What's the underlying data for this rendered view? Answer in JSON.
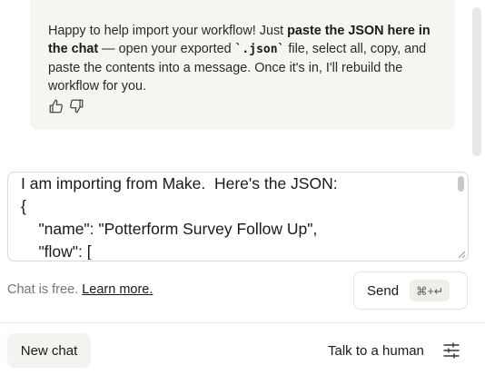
{
  "message": {
    "p1": "Happy to help import your workflow! Just ",
    "b1": "paste the JSON here in the chat",
    "p2": " — open your exported ",
    "code": "`.json`",
    "p3": " file, select all, copy, and paste the contents into a message. Once it's in, I'll rebuild the workflow for you.",
    "reactions": [
      "thumbs-up-icon",
      "thumbs-down-icon"
    ]
  },
  "composer": {
    "value": "I am importing from Make.  Here's the JSON:\n{\n    \"name\": \"Potterform Survey Follow Up\",\n    \"flow\": ["
  },
  "footer": {
    "free_text": "Chat is free.",
    "learn_more": "Learn more.",
    "send_label": "Send",
    "shortcut": "⌘+↵"
  },
  "bottom": {
    "new_chat": "New chat",
    "talk_human": "Talk to a human",
    "settings_icon": "sliders-icon"
  },
  "colors": {
    "bubble_bg": "#f6f5f1",
    "muted_text": "#757575",
    "button_bg": "#f4f3ef"
  }
}
